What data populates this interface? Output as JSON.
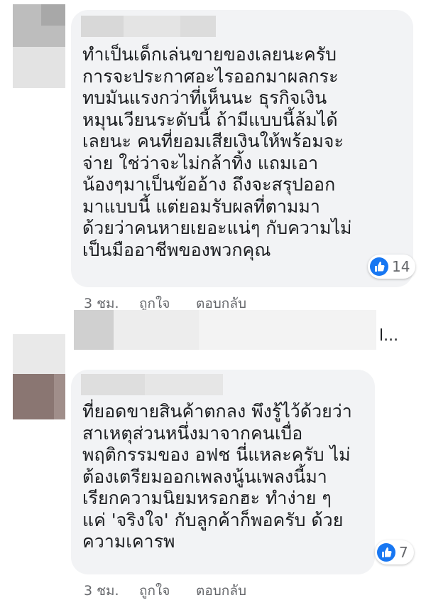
{
  "comments": [
    {
      "text": "ทำเป็นเด็กเล่นขายของเลยนะครับ\nการจะประกาศอะไรออกมาผลกระ\nทบมันแรงกว่าที่เห็นนะ ธุรกิจเงิน\nหมุนเวียนระดับนี้ ถ้ามีแบบนี้ล้มได้\nเลยนะ คนที่ยอมเสียเงินให้พร้อมจะ\nจ่าย ใช่ว่าจะไม่กล้าทิ้ง แถมเอา\nน้องๆมาเป็นข้ออ้าง ถึงจะสรุปออก\nมาแบบนี้ แต่ยอมรับผลที่ตามมา\nด้วยว่าคนหายเยอะแน่ๆ กับความไม่\nเป็นมืออาชีพของพวกคุณ",
      "like_count": "14",
      "time": "3 ชม.",
      "like_label": "ถูกใจ",
      "reply_label": "ตอบกลับ"
    },
    {
      "text": "ที่ยอดขายสินค้าตกลง พึงรู้ไว้ด้วยว่า\nสาเหตุส่วนหนึ่งมาจากคนเบื่อ\nพฤติกรรมของ อฟช นี่แหละครับ ไม่\nต้องเตรียมออกเพลงนู้นเพลงนี้มา\nเรียกความนิยมหรอกฮะ ทำง่าย ๆ\nแค่ 'จริงใจ' กับลูกค้าก็พอครับ ด้วย\nความเคารพ",
      "like_count": "7",
      "time": "3 ชม.",
      "like_label": "ถูกใจ",
      "reply_label": "ตอบกลับ"
    }
  ],
  "reply_preview": {
    "ellipsis": "l..."
  },
  "colors": {
    "bubble": "#f2f3f5",
    "text": "#1c1e21",
    "meta": "#65676b",
    "like_blue": "#1877f2"
  }
}
